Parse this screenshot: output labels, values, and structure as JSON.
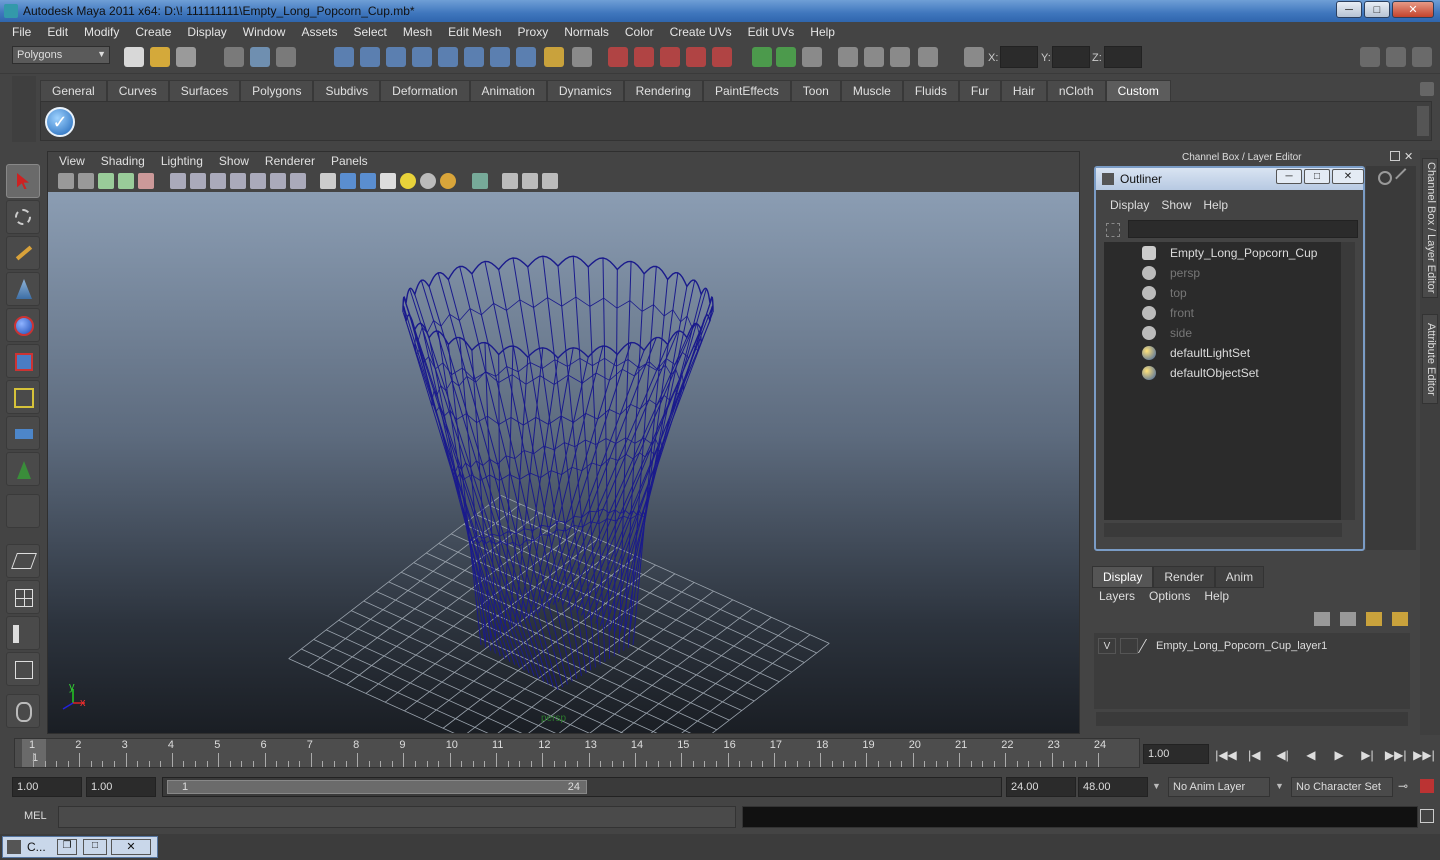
{
  "window": {
    "title": "Autodesk Maya 2011 x64: D:\\! 111111111\\Empty_Long_Popcorn_Cup.mb*",
    "buttons": [
      "─",
      "□",
      "✕"
    ]
  },
  "menubar": [
    "File",
    "Edit",
    "Modify",
    "Create",
    "Display",
    "Window",
    "Assets",
    "Select",
    "Mesh",
    "Edit Mesh",
    "Proxy",
    "Normals",
    "Color",
    "Create UVs",
    "Edit UVs",
    "Help"
  ],
  "statusline": {
    "mode": "Polygons",
    "x_label": "X:",
    "y_label": "Y:",
    "z_label": "Z:"
  },
  "shelf": {
    "tabs": [
      "General",
      "Curves",
      "Surfaces",
      "Polygons",
      "Subdivs",
      "Deformation",
      "Animation",
      "Dynamics",
      "Rendering",
      "PaintEffects",
      "Toon",
      "Muscle",
      "Fluids",
      "Fur",
      "Hair",
      "nCloth",
      "Custom"
    ],
    "active_tab": "Custom",
    "check_glyph": "✓"
  },
  "viewport": {
    "menu": [
      "View",
      "Shading",
      "Lighting",
      "Show",
      "Renderer",
      "Panels"
    ],
    "camera_label": "persp",
    "axis_y": "y",
    "axis_x": "x",
    "wire_color": "#1a1a8c"
  },
  "channel_box": {
    "header": "Channel Box / Layer Editor",
    "side_tabs": [
      "Channel Box / Layer Editor",
      "Attribute Editor"
    ]
  },
  "outliner": {
    "title": "Outliner",
    "menu": [
      "Display",
      "Show",
      "Help"
    ],
    "items": [
      {
        "label": "Empty_Long_Popcorn_Cup",
        "dim": false
      },
      {
        "label": "persp",
        "dim": true
      },
      {
        "label": "top",
        "dim": true
      },
      {
        "label": "front",
        "dim": true
      },
      {
        "label": "side",
        "dim": true
      },
      {
        "label": "defaultLightSet",
        "dim": false
      },
      {
        "label": "defaultObjectSet",
        "dim": false
      }
    ]
  },
  "layer_editor": {
    "tabs": [
      "Display",
      "Render",
      "Anim"
    ],
    "active_tab": "Display",
    "menu": [
      "Layers",
      "Options",
      "Help"
    ],
    "layer": {
      "visible": "V",
      "name": "Empty_Long_Popcorn_Cup_layer1"
    }
  },
  "timeline": {
    "ticks": [
      "1",
      "2",
      "3",
      "4",
      "5",
      "6",
      "7",
      "8",
      "9",
      "10",
      "11",
      "12",
      "13",
      "14",
      "15",
      "16",
      "17",
      "18",
      "19",
      "20",
      "21",
      "22",
      "23",
      "24"
    ],
    "current_frame": "1",
    "current_time": "1.00",
    "playback": [
      "|◀◀",
      "|◀",
      "◀|",
      "◀",
      "▶",
      "▶|",
      "▶▶|",
      "▶▶|"
    ]
  },
  "range": {
    "start": "1.00",
    "anim_start": "1.00",
    "range_start_label": "1",
    "range_end_label": "24",
    "end": "24.00",
    "anim_end": "48.00",
    "anim_layer": "No Anim Layer",
    "character_set": "No Character Set"
  },
  "command_line": {
    "label": "MEL"
  },
  "helpline": {
    "minimized_label": "C..."
  }
}
